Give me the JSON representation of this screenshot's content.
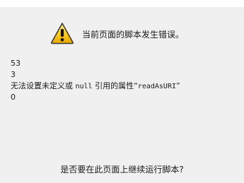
{
  "header": {
    "icon": "warning-icon",
    "title": "当前页面的脚本发生错误。"
  },
  "details": {
    "line": "53",
    "char": "3",
    "error_prefix": "无法设置未定义或 ",
    "error_null": "null",
    "error_middle": " 引用的属性“",
    "error_prop": "readAsURI",
    "error_suffix": "”",
    "code": "0"
  },
  "question": "是否要在此页面上继续运行脚本?",
  "colors": {
    "icon_yellow": "#ffd21f",
    "icon_border": "#3a3a3a",
    "background": "#f0f0f0"
  }
}
